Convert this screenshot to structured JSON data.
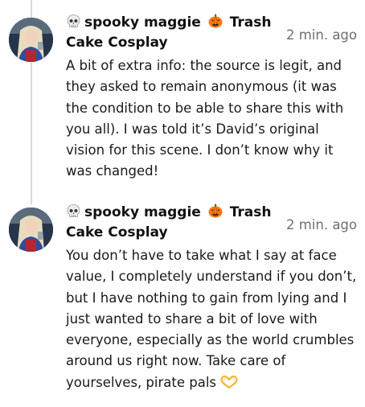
{
  "comments": [
    {
      "author_prefix_icon": "skull-icon",
      "author_name_part1": "spooky maggie",
      "author_mid_icon": "pumpkin-icon",
      "author_name_part2": "Trash Cake Cosplay",
      "timestamp": "2 min. ago",
      "body": "A bit of extra info: the source is legit, and they asked to remain anonymous (it was the condition to be able to share this with you all). I was told it’s David’s original vision for this scene. I don’t know why it was changed!"
    },
    {
      "author_prefix_icon": "skull-icon",
      "author_name_part1": "spooky maggie",
      "author_mid_icon": "pumpkin-icon",
      "author_name_part2": "Trash Cake Cosplay",
      "timestamp": "2 min. ago",
      "body": "You don’t have to take what I say at face value, I completely understand if you don’t, but I have nothing to gain from lying and I just wanted to share a bit of love with everyone, especially as the world crumbles around us right now. Take care of yourselves, pirate pals",
      "body_end_icon": "heart-hands-icon"
    }
  ],
  "colors": {
    "text": "#111111",
    "timestamp": "#6e6e78",
    "thread_line": "#d7d7dc"
  }
}
